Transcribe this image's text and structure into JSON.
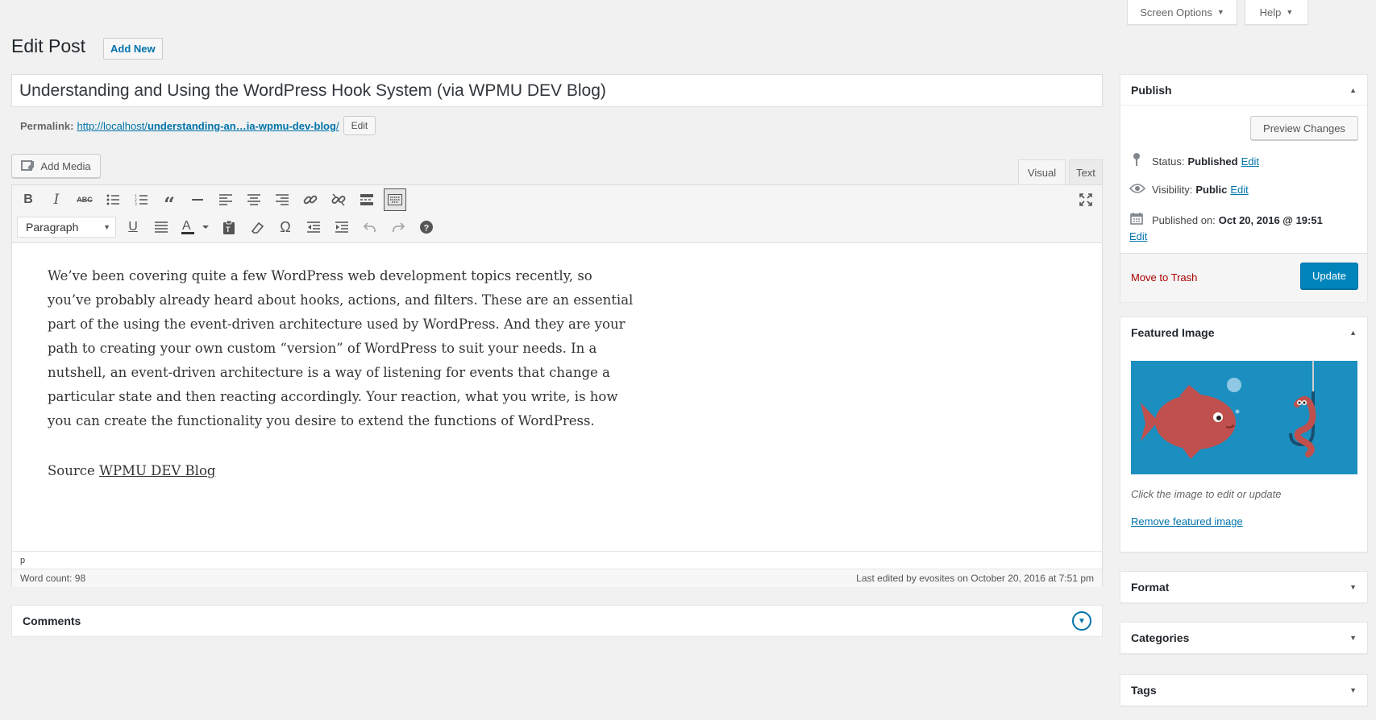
{
  "top_tabs": {
    "screen_options": "Screen Options",
    "help": "Help"
  },
  "header": {
    "title": "Edit Post",
    "add_new": "Add New"
  },
  "post": {
    "title": "Understanding and Using the WordPress Hook System (via WPMU DEV Blog)"
  },
  "permalink": {
    "label": "Permalink:",
    "base": "http://localhost/",
    "slug": "understanding-an…ia-wpmu-dev-blog",
    "trailing": "/",
    "edit": "Edit"
  },
  "media": {
    "add_media": "Add Media"
  },
  "editor_tabs": {
    "visual": "Visual",
    "text": "Text"
  },
  "toolbar": {
    "format": "Paragraph",
    "row1_icons": [
      "bold-icon",
      "italic-icon",
      "strikethrough-icon",
      "bullet-list-icon",
      "numbered-list-icon",
      "blockquote-icon",
      "horizontal-line-icon",
      "align-left-icon",
      "align-center-icon",
      "align-right-icon",
      "link-icon",
      "unlink-icon",
      "read-more-icon",
      "toolbar-toggle-icon",
      "fullscreen-icon"
    ],
    "row2_icons": [
      "underline-icon",
      "justify-icon",
      "text-color-icon",
      "paste-text-icon",
      "clear-formatting-icon",
      "special-character-icon",
      "outdent-icon",
      "indent-icon",
      "undo-icon",
      "redo-icon",
      "help-icon"
    ]
  },
  "content": {
    "paragraph": "We’ve been covering quite a few WordPress web development topics recently, so you’ve probably already heard about hooks, actions, and filters.  These are an essential part of the using the event-driven architecture used by WordPress.  And they are your path to creating your own custom “version” of WordPress to suit your needs. In a nutshell, an event-driven architecture is a way of listening for events that change a particular state and then reacting accordingly. Your reaction, what you write, is how you can create the functionality you desire to extend the functions of WordPress.",
    "source_label": "Source",
    "source_link": "WPMU DEV Blog"
  },
  "editor_footer": {
    "path": "p",
    "word_count": "Word count: 98",
    "last_edited": "Last edited by evosites on October 20, 2016 at 7:51 pm"
  },
  "comments": {
    "title": "Comments"
  },
  "publish": {
    "title": "Publish",
    "preview": "Preview Changes",
    "status_label": "Status:",
    "status_value": "Published",
    "visibility_label": "Visibility:",
    "visibility_value": "Public",
    "published_label": "Published on:",
    "published_value": "Oct 20, 2016 @ 19:51",
    "edit": "Edit",
    "trash": "Move to Trash",
    "update": "Update"
  },
  "featured_image": {
    "title": "Featured Image",
    "caption": "Click the image to edit or update",
    "remove": "Remove featured image"
  },
  "boxes": {
    "format": "Format",
    "categories": "Categories",
    "tags": "Tags"
  },
  "colors": {
    "primary": "#0085ba",
    "link": "#0073aa",
    "trash": "#aa0000",
    "background": "#f1f1f1"
  }
}
